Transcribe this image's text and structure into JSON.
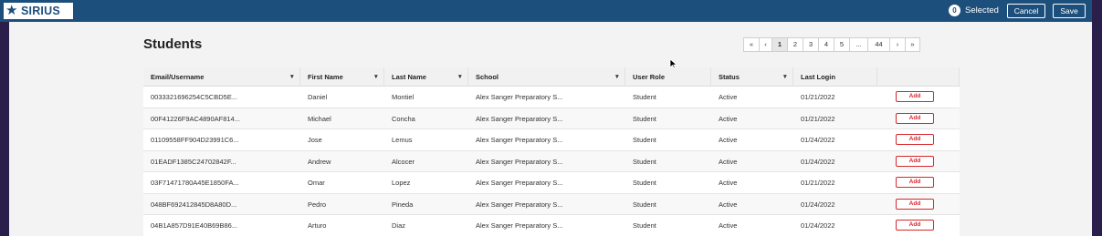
{
  "header": {
    "logo_text": "SIRIUS",
    "selected_count": "0",
    "selected_label": "Selected",
    "cancel_label": "Cancel",
    "save_label": "Save",
    "bar_color": "#1d4f7c"
  },
  "page": {
    "title": "Students"
  },
  "pagination": [
    "«",
    "‹",
    "1",
    "2",
    "3",
    "4",
    "5",
    "...",
    "44",
    "›",
    "»"
  ],
  "pagination_active": "1",
  "table": {
    "columns": [
      "Email/Username",
      "First Name",
      "Last Name",
      "School",
      "User Role",
      "Status",
      "Last Login",
      ""
    ],
    "action_label": "Add",
    "action_color": "#d8262b",
    "rows": [
      [
        "0033321696254C5CBD5E...",
        "Daniel",
        "Montiel",
        "Alex Sanger Preparatory S...",
        "Student",
        "Active",
        "01/21/2022"
      ],
      [
        "00F41226F9AC4890AF814...",
        "Michael",
        "Concha",
        "Alex Sanger Preparatory S...",
        "Student",
        "Active",
        "01/21/2022"
      ],
      [
        "01109558FF904D23991C6...",
        "Jose",
        "Lemus",
        "Alex Sanger Preparatory S...",
        "Student",
        "Active",
        "01/24/2022"
      ],
      [
        "01EADF1385C24702842F...",
        "Andrew",
        "Alcocer",
        "Alex Sanger Preparatory S...",
        "Student",
        "Active",
        "01/24/2022"
      ],
      [
        "03F71471780A45E1850FA...",
        "Omar",
        "Lopez",
        "Alex Sanger Preparatory S...",
        "Student",
        "Active",
        "01/21/2022"
      ],
      [
        "048BF692412845D8A80D...",
        "Pedro",
        "Pineda",
        "Alex Sanger Preparatory S...",
        "Student",
        "Active",
        "01/24/2022"
      ],
      [
        "04B1A857D91E40B69B86...",
        "Arturo",
        "Diaz",
        "Alex Sanger Preparatory S...",
        "Student",
        "Active",
        "01/24/2022"
      ]
    ]
  }
}
